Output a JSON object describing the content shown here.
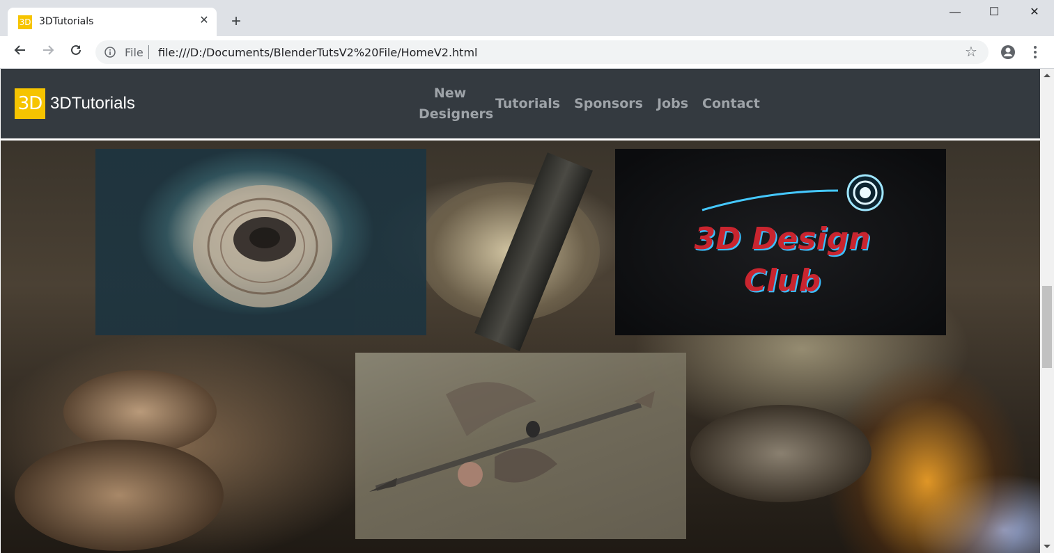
{
  "browser": {
    "tab_title": "3DTutorials",
    "favicon_text": "3D",
    "tab_close": "✕",
    "new_tab": "+",
    "scheme_label": "File",
    "url": "file:///D:/Documents/BlenderTutsV2%20File/HomeV2.html",
    "window_controls": {
      "minimize": "—",
      "maximize": "☐",
      "close": "✕"
    }
  },
  "site": {
    "logo_text": "3D",
    "brand_name": "3DTutorials",
    "nav": [
      "New Designers",
      "Tutorials",
      "Sponsors",
      "Jobs",
      "Contact"
    ],
    "brand_color": "#f6c400",
    "navbar_color": "#343a40"
  },
  "hero": {
    "logo_art": {
      "line1": "3D Design",
      "line2": "Club"
    }
  },
  "icons": {
    "back": "arrow-left-icon",
    "forward": "arrow-right-icon",
    "reload": "reload-icon",
    "info": "info-icon",
    "bookmark": "star-icon",
    "profile": "account-icon",
    "menu": "kebab-menu-icon"
  }
}
